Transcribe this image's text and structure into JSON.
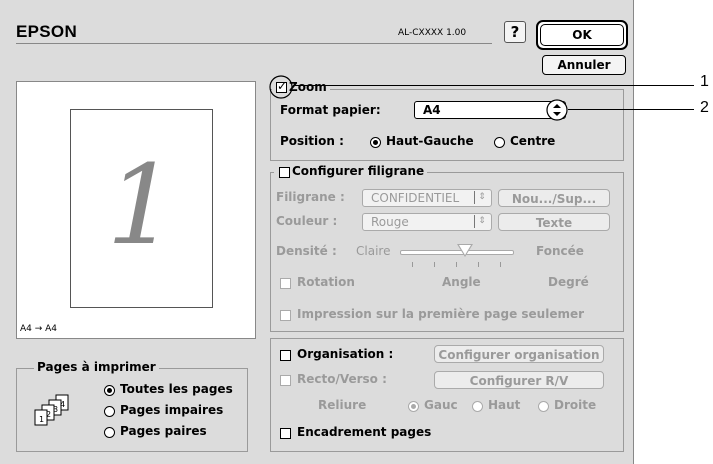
{
  "header": {
    "brand": "EPSON",
    "model": "AL-CXXXX 1.00",
    "help_label": "?",
    "ok_label": "OK",
    "cancel_label": "Annuler"
  },
  "preview": {
    "page_number": "1",
    "size_label": "A4 → A4"
  },
  "pages_group": {
    "title": "Pages à imprimer",
    "options": [
      "Toutes les pages",
      "Pages impaires",
      "Pages paires"
    ],
    "selected": "Toutes les pages",
    "icon_numbers": [
      "1",
      "2",
      "3",
      "4"
    ]
  },
  "zoom": {
    "title": "Zoom",
    "checked": true,
    "paper_label": "Format papier:",
    "paper_value": "A4",
    "position_label": "Position :",
    "position_options": [
      "Haut-Gauche",
      "Centre"
    ],
    "position_selected": "Haut-Gauche"
  },
  "watermark": {
    "title": "Configurer filigrane",
    "checked": false,
    "filigrane_label": "Filigrane :",
    "filigrane_value": "CONFIDENTIEL",
    "new_button": "Nou.../Sup...",
    "color_label": "Couleur :",
    "color_value": "Rouge",
    "text_button": "Texte",
    "density_label": "Densité :",
    "density_low": "Claire",
    "density_high": "Foncée",
    "density_level": 0.5,
    "rotation_label": "Rotation",
    "angle_label": "Angle",
    "degree_label": "Degré",
    "first_page_label": "Impression sur la première page seulemer"
  },
  "layout": {
    "organisation_label": "Organisation :",
    "organisation_button": "Configurer organisation",
    "duplex_label": "Recto/Verso :",
    "duplex_button": "Configurer R/V",
    "binding_label": "Reliure",
    "binding_options": [
      "Gauc",
      "Haut",
      "Droite"
    ],
    "binding_selected": "Gauc",
    "frame_label": "Encadrement pages"
  },
  "callouts": [
    "1",
    "2"
  ]
}
